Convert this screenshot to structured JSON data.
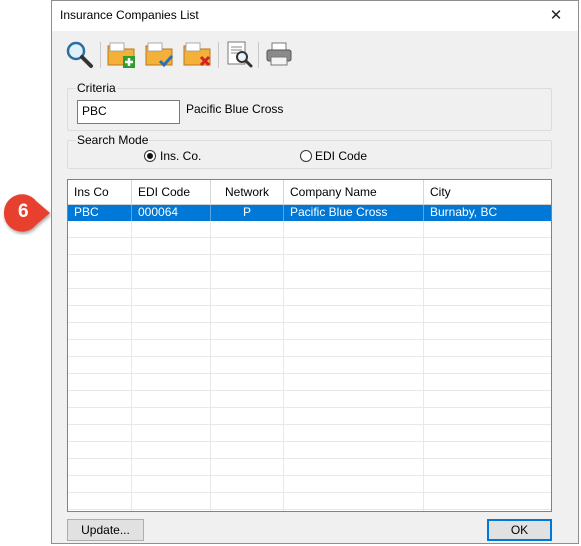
{
  "callout": {
    "number": "6",
    "color": "#e8412e"
  },
  "dialog": {
    "title": "Insurance Companies List",
    "close_glyph": "✕"
  },
  "toolbar": {
    "icons": [
      "search-icon",
      "add-folder-icon",
      "edit-folder-icon",
      "delete-folder-icon",
      "preview-report-icon",
      "print-icon"
    ]
  },
  "criteria": {
    "legend": "Criteria",
    "value": "PBC",
    "company_name": "Pacific Blue Cross"
  },
  "search_mode": {
    "legend": "Search Mode",
    "options": [
      {
        "label": "Ins. Co.",
        "selected": true
      },
      {
        "label": "EDI Code",
        "selected": false
      }
    ]
  },
  "grid": {
    "columns": [
      "Ins Co",
      "EDI Code",
      "Network",
      "Company Name",
      "City"
    ],
    "rows": [
      {
        "ins_co": "PBC",
        "edi_code": "000064",
        "network": "P",
        "company_name": "Pacific Blue Cross",
        "city": "Burnaby, BC",
        "selected": true
      }
    ],
    "selection_color": "#0078d7"
  },
  "buttons": {
    "update": "Update...",
    "ok": "OK"
  }
}
